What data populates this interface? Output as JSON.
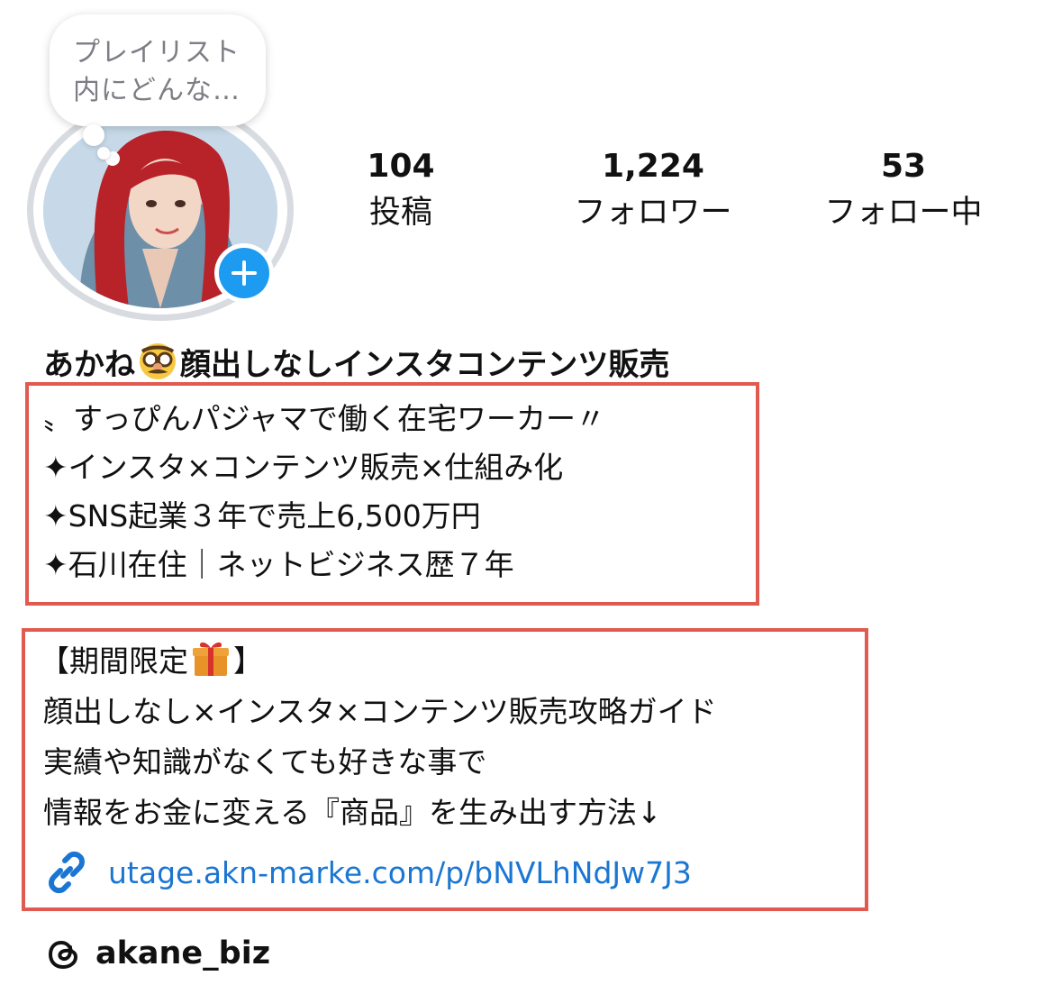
{
  "note": {
    "text_line1": "プレイリスト",
    "text_line2": "内にどんな…"
  },
  "avatar": {
    "accent_color": "#1d9bf0"
  },
  "stats": [
    {
      "value": "104",
      "label": "投稿"
    },
    {
      "value": "1,224",
      "label": "フォロワー"
    },
    {
      "value": "53",
      "label": "フォロー中"
    }
  ],
  "profile": {
    "name_part1": "あかね",
    "name_emoji": "disguised-face-emoji",
    "name_part2": "顔出しなしインスタコンテンツ販売"
  },
  "bio": {
    "lines": [
      "〟すっぴんパジャマで働く在宅ワーカー〃",
      "✦インスタ×コンテンツ販売×仕組み化",
      "✦SNS起業３年で売上6,500万円",
      "✦石川在住｜ネットビジネス歴７年"
    ]
  },
  "promo": {
    "heading_prefix": "【期間限定",
    "heading_emoji": "gift-emoji",
    "heading_suffix": "】",
    "lines": [
      "顔出しなし×インスタ×コンテンツ販売攻略ガイド",
      "実績や知識がなくても好きな事で",
      "情報をお金に変える『商品』を生み出す方法↓"
    ]
  },
  "link": {
    "url_text": "utage.akn-marke.com/p/bNVLhNdJw7J3",
    "color": "#1a76d2"
  },
  "threads": {
    "handle": "akane_biz"
  },
  "highlight_box_color": "#e05a50"
}
